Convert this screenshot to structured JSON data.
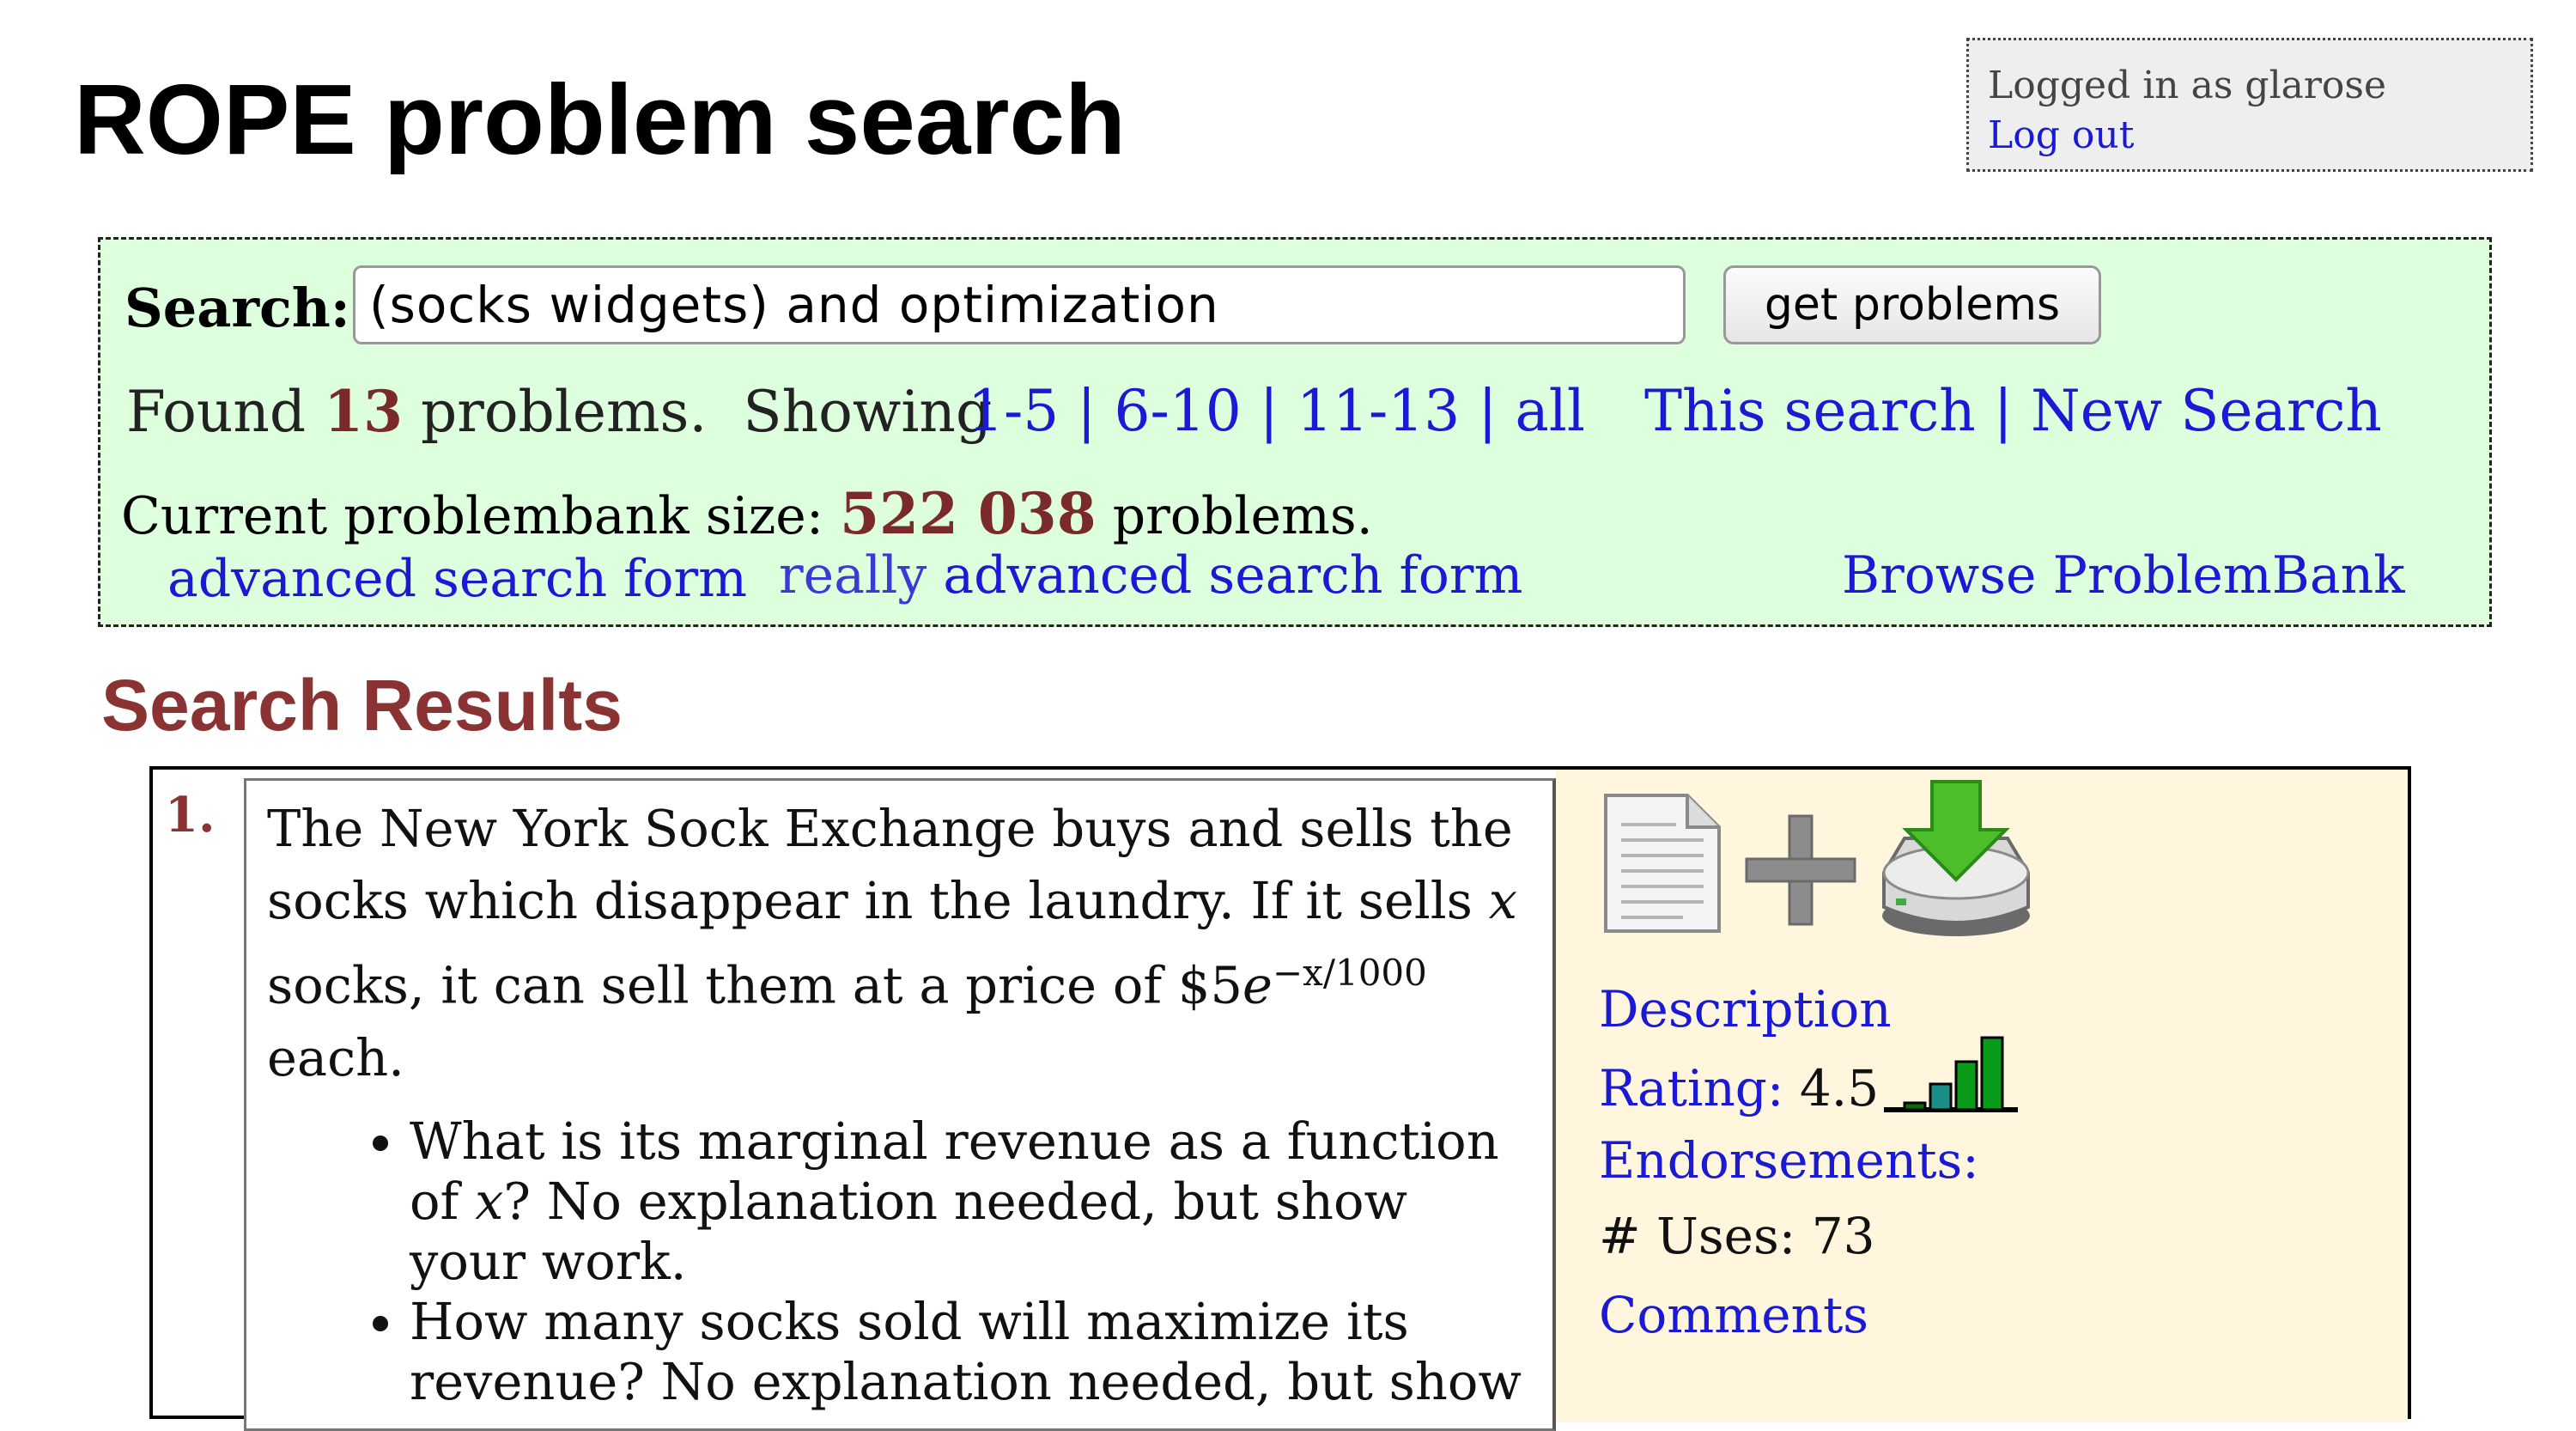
{
  "login": {
    "status": "Logged in as glarose",
    "logout": "Log out"
  },
  "page": {
    "title": "ROPE problem search"
  },
  "search": {
    "label": "Search:",
    "query": "(socks widgets) and optimization",
    "button": "get problems",
    "found_prefix": "Found",
    "found_count": "13",
    "found_suffix": "problems.",
    "showing": "Showing",
    "pages": [
      "1-5",
      "6-10",
      "11-13",
      "all"
    ],
    "this_search": "This search",
    "new_search": "New Search",
    "bank_prefix": "Current problembank size:",
    "bank_size": "522 038",
    "bank_suffix": "problems.",
    "advanced_link": "advanced search form",
    "really_word": "really",
    "really_link": "advanced search form",
    "browse_link": "Browse ProblemBank"
  },
  "results": {
    "heading": "Search Results",
    "items": [
      {
        "number": "1.",
        "text_line1": "The New York Sock Exchange buys and sells the socks which disappear in the laundry. If it sells",
        "var_x": "x",
        "text_line2": "socks, it can sell them at a price of $5",
        "math_e": "e",
        "exponent": "−x/1000",
        "text_line3": "each.",
        "bullets": [
          {
            "before": "What is its marginal revenue as a function of",
            "var": "x",
            "after": "? No explanation needed, but show your work."
          },
          {
            "before": "How many socks sold will maximize its revenue? No explanation needed, but show",
            "var": "",
            "after": ""
          }
        ],
        "description": "Description",
        "rating_label": "Rating:",
        "rating_value": "4.5",
        "endorsements": "Endorsements:",
        "uses": "# Uses: 73",
        "comments": "Comments",
        "icons": {
          "document": "document-icon",
          "add": "plus-icon",
          "download": "download-icon",
          "rating": "signal-bars-icon"
        }
      }
    ]
  },
  "colors": {
    "panel_bg": "#ddffdd",
    "link": "#1a1ad6",
    "accent": "#8b3333",
    "side_bg": "#fff6dd"
  }
}
